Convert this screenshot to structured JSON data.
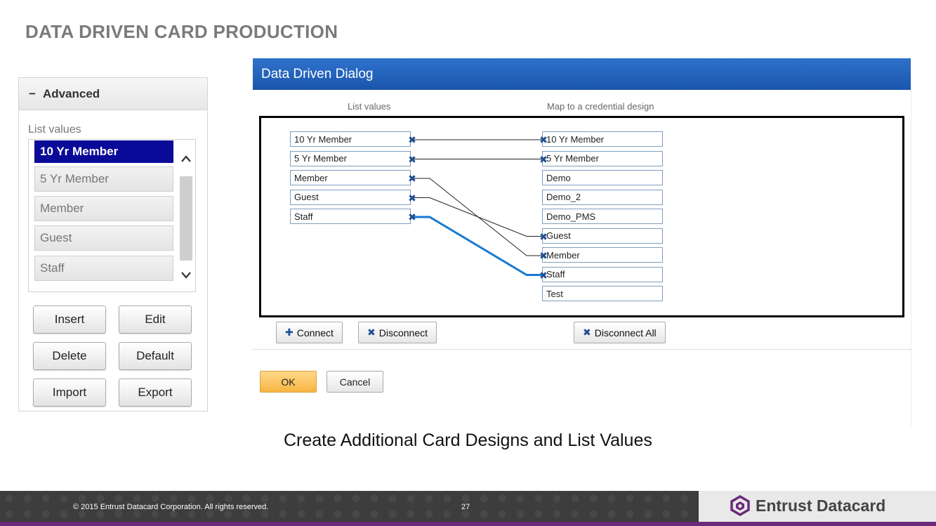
{
  "slide": {
    "title": "DATA DRIVEN CARD PRODUCTION",
    "caption": "Create Additional Card Designs and List Values"
  },
  "advanced": {
    "header": "Advanced",
    "list_label": "List values",
    "items": [
      "10 Yr Member",
      "5 Yr Member",
      "Member",
      "Guest",
      "Staff"
    ],
    "selected_index": 0,
    "buttons": {
      "insert": "Insert",
      "edit": "Edit",
      "delete": "Delete",
      "default": "Default",
      "import": "Import",
      "export": "Export"
    }
  },
  "dialog": {
    "title": "Data Driven Dialog",
    "col_list_values": "List values",
    "col_map": "Map to a credential design",
    "list_values": [
      "10 Yr Member",
      "5 Yr Member",
      "Member",
      "Guest",
      "Staff"
    ],
    "designs": [
      "10 Yr Member",
      "5 Yr Member",
      "Demo",
      "Demo_2",
      "Demo_PMS",
      "Guest",
      "Member",
      "Staff",
      "Test"
    ],
    "mappings": [
      {
        "from": "10 Yr Member",
        "to": "10 Yr Member"
      },
      {
        "from": "5 Yr Member",
        "to": "5 Yr Member"
      },
      {
        "from": "Member",
        "to": "Member"
      },
      {
        "from": "Guest",
        "to": "Guest"
      },
      {
        "from": "Staff",
        "to": "Staff",
        "selected": true
      }
    ],
    "buttons": {
      "connect": "Connect",
      "disconnect": "Disconnect",
      "disconnect_all": "Disconnect All",
      "ok": "OK",
      "cancel": "Cancel"
    },
    "colors": {
      "titlebar": "#1f5fbf",
      "link": "#222222",
      "selected_link": "#1a7ad0",
      "ok": "#f6b542"
    }
  },
  "footer": {
    "copyright": "© 2015 Entrust Datacard Corporation. All rights reserved.",
    "page_number": "27",
    "brand": "Entrust Datacard",
    "brand_color": "#6b2a7a"
  }
}
